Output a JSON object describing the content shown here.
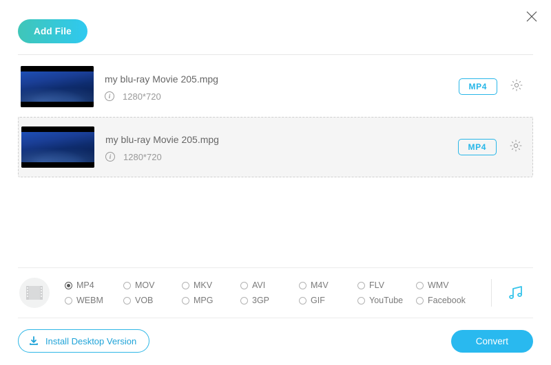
{
  "close_label": "Close",
  "add_file_label": "Add File",
  "files": [
    {
      "name": "my blu-ray Movie 205.mpg",
      "resolution": "1280*720",
      "format": "MP4",
      "selected": false
    },
    {
      "name": "my blu-ray Movie 205.mpg",
      "resolution": "1280*720",
      "format": "MP4",
      "selected": true
    }
  ],
  "formats": {
    "selected": "MP4",
    "options": [
      "MP4",
      "MOV",
      "MKV",
      "AVI",
      "M4V",
      "FLV",
      "WMV",
      "WEBM",
      "VOB",
      "MPG",
      "3GP",
      "GIF",
      "YouTube",
      "Facebook"
    ]
  },
  "install_label": "Install Desktop Version",
  "convert_label": "Convert"
}
